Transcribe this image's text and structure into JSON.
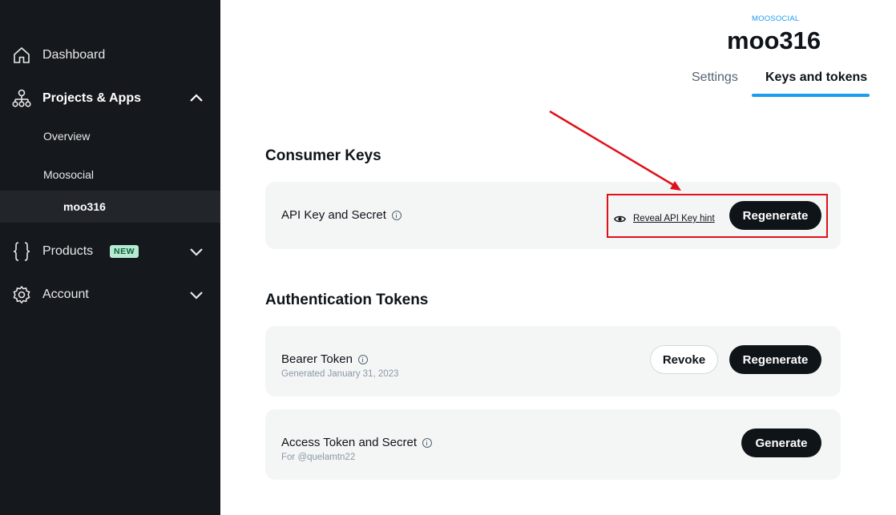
{
  "sidebar": {
    "dashboard": "Dashboard",
    "projects_apps": "Projects & Apps",
    "overview": "Overview",
    "project": "Moosocial",
    "app": "moo316",
    "products": "Products",
    "products_badge": "NEW",
    "account": "Account"
  },
  "header": {
    "org": "MOOSOCIAL",
    "title": "moo316",
    "tabs": [
      "Settings",
      "Keys and tokens"
    ],
    "active_tab": "Keys and tokens"
  },
  "consumer_keys": {
    "title": "Consumer Keys",
    "api_key_label": "API Key and Secret",
    "reveal_link": "Reveal API Key hint",
    "regenerate": "Regenerate"
  },
  "auth_tokens": {
    "title": "Authentication Tokens",
    "bearer": {
      "label": "Bearer Token",
      "sub": "Generated January 31, 2023",
      "revoke": "Revoke",
      "regenerate": "Regenerate"
    },
    "access": {
      "label": "Access Token and Secret",
      "sub": "For @quelamtn22",
      "generate": "Generate"
    }
  },
  "colors": {
    "sidebar_bg": "#15181c",
    "accent": "#1d9bf0",
    "annotation": "#e0101a",
    "button_dark": "#0f1419"
  },
  "icons": {
    "dashboard": "home-icon",
    "projects": "sitemap-icon",
    "products": "braces-icon",
    "account": "gear-icon",
    "reveal": "eye-icon",
    "info": "info-icon"
  }
}
